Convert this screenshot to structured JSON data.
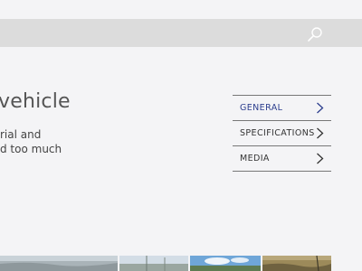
{
  "header": {
    "search_icon": "search-icon"
  },
  "main": {
    "headline": "vehicle",
    "body_lines": [
      "rial and",
      "d too much"
    ]
  },
  "side_nav": {
    "items": [
      {
        "label": "GENERAL",
        "active": true
      },
      {
        "label": "SPECIFICATIONS",
        "active": false
      },
      {
        "label": "MEDIA",
        "active": false
      }
    ],
    "icon": "chevron-right-icon"
  },
  "colors": {
    "accent": "#2c3e8e",
    "topbar": "#dcdcdc",
    "background": "#f4f4f6"
  }
}
